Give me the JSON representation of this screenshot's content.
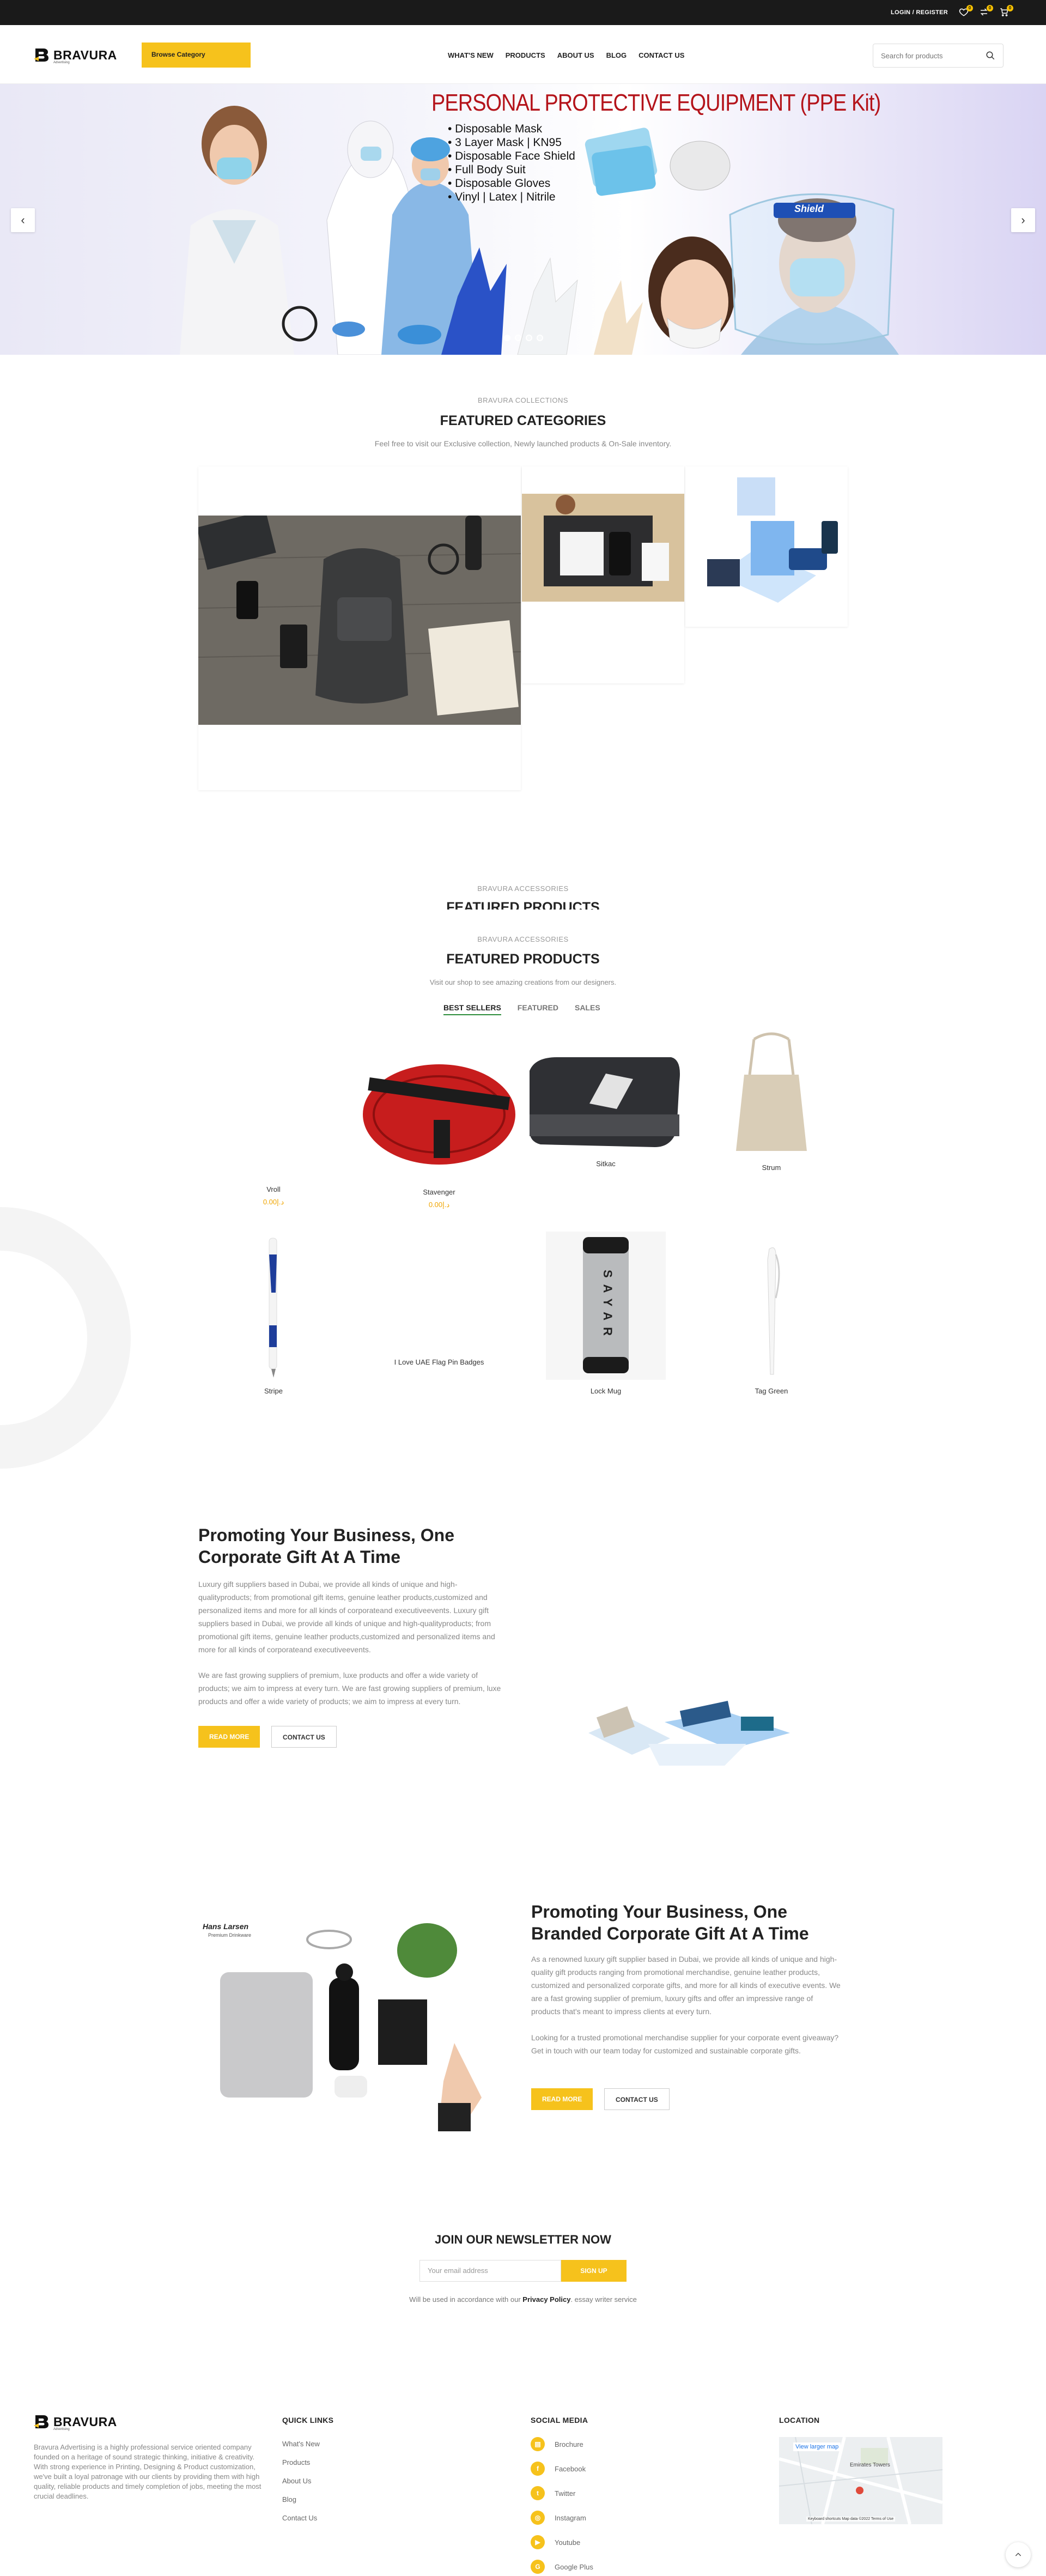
{
  "topbar": {
    "login_label": "LOGIN / REGISTER",
    "wishlist_count": "0",
    "compare_count": "0",
    "cart_count": "0"
  },
  "header": {
    "logo_text": "BRAVURA",
    "logo_sub": "Advertising",
    "browse_label": "Browse Category",
    "nav": [
      "WHAT'S NEW",
      "PRODUCTS",
      "ABOUT US",
      "BLOG",
      "CONTACT US"
    ],
    "search_placeholder": "Search for products"
  },
  "hero": {
    "title": "PERSONAL PROTECTIVE EQUIPMENT (PPE Kit)",
    "items": [
      "• Disposable Mask",
      "• 3 Layer Mask | KN95",
      "• Disposable Face Shield",
      "• Full Body Suit",
      "• Disposable Gloves",
      "• Vinyl | Latex | Nitrile"
    ],
    "shield_label": "Shield",
    "slide_count": 4,
    "active_slide": 1
  },
  "categories": {
    "subtitle": "BRAVURA COLLECTIONS",
    "title": "FEATURED CATEGORIES",
    "desc": "Feel free to visit our Exclusive collection, Newly launched products & On-Sale inventory."
  },
  "accessories_ghost": {
    "subtitle": "BRAVURA ACCESSORIES",
    "title": "FEATURED PRODUCTS"
  },
  "products": {
    "subtitle": "BRAVURA ACCESSORIES",
    "title": "FEATURED PRODUCTS",
    "desc": "Visit our shop to see amazing creations from our designers.",
    "tabs": [
      "BEST SELLERS",
      "FEATURED",
      "SALES"
    ],
    "items": [
      {
        "name": "Vroll",
        "price": "د.إ0.00"
      },
      {
        "name": "Stavenger",
        "price": "د.إ0.00"
      },
      {
        "name": "Sitkac"
      },
      {
        "name": "Strum"
      },
      {
        "name": "Stripe"
      },
      {
        "name": "I Love UAE Flag Pin Badges"
      },
      {
        "name": "Lock Mug"
      },
      {
        "name": "Tag Green"
      }
    ],
    "mug_brand": "SAYAR"
  },
  "promo1": {
    "title": "Promoting Your Business, One Corporate Gift At A Time",
    "p1": "Luxury gift suppliers based in Dubai, we provide all kinds of unique and high-qualityproducts; from promotional gift items, genuine leather products,customized and personalized items and more for all kinds of corporateand executiveevents. Luxury gift suppliers based in Dubai, we provide all kinds of unique and high-qualityproducts; from promotional gift items, genuine leather products,customized and personalized items and more for all kinds of corporateand executiveevents.",
    "p2": "We are fast growing suppliers of premium, luxe products and offer a wide variety of products; we aim to impress at every turn. We are fast growing suppliers of premium, luxe products and offer a wide variety of products; we aim to impress at every turn.",
    "read_more": "READ MORE",
    "contact": "CONTACT US"
  },
  "promo2": {
    "title": "Promoting Your Business, One Branded Corporate Gift At A Time",
    "p1": "As a renowned luxury gift supplier based in Dubai, we provide all kinds of unique and high-quality gift products ranging from promotional merchandise, genuine leather products, customized and personalized corporate gifts, and more for all kinds of executive events. We are a fast growing supplier of premium, luxury gifts and offer an impressive range of products that's meant to impress clients at every turn.",
    "p2": "Looking for a trusted promotional merchandise supplier for your corporate event giveaway? Get in touch with our team today for customized and sustainable corporate gifts.",
    "read_more": "READ MORE",
    "contact": "CONTACT US",
    "brand_label": "Hans Larsen",
    "brand_sub": "Premium Drinkware"
  },
  "newsletter": {
    "title": "JOIN OUR NEWSLETTER NOW",
    "placeholder": "Your email address",
    "button": "SIGN UP",
    "note_pre": "Will be used in accordance with our ",
    "note_link": "Privacy Policy",
    "note_post": ". essay writer service"
  },
  "footer": {
    "about": "Bravura Advertising is a highly professional service oriented company founded on a heritage of sound strategic thinking, initiative & creativity. With strong experience in Printing, Designing & Product customization, we've built a loyal patronage with our clients by providing them with high quality, reliable products and timely completion of jobs, meeting the most crucial deadlines.",
    "quick_links_title": "QUICK LINKS",
    "quick_links": [
      "What's New",
      "Products",
      "About Us",
      "Blog",
      "Contact Us"
    ],
    "social_title": "SOCIAL MEDIA",
    "social": [
      "Brochure",
      "Facebook",
      "Twitter",
      "Instagram",
      "Youtube",
      "Google Plus"
    ],
    "location_title": "LOCATION",
    "map_link": "View larger map",
    "map_place": "Emirates Towers",
    "map_footer": "Keyboard shortcuts  Map data ©2022   Terms of Use"
  },
  "colors": {
    "accent": "#f6c21c",
    "hero_title": "#b4131a",
    "topbar": "#1a1a1a",
    "tab_underline": "#2c8c3a"
  }
}
